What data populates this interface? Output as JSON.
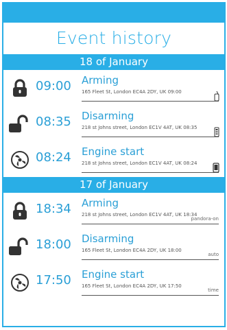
{
  "app": {
    "title": "Event history"
  },
  "groups": [
    {
      "date": "18 of January",
      "events": [
        {
          "icon": "lock-closed-icon",
          "time": "09:00",
          "event": "Arming",
          "address": "165 Fleet St, London EC4A 2DY, UK 09:00",
          "source": "",
          "device": "key-fob-icon"
        },
        {
          "icon": "lock-open-icon",
          "time": "08:35",
          "event": "Disarming",
          "address": "218 st Johns street, London EC1V 4AT, UK 08:35",
          "source": "",
          "device": "remote-icon"
        },
        {
          "icon": "engine-icon",
          "time": "08:24",
          "event": "Engine start",
          "address": "218 st Johns street, London EC1V 4AT, UK 08:24",
          "source": "",
          "device": "phone-icon"
        }
      ]
    },
    {
      "date": "17 of January",
      "events": [
        {
          "icon": "lock-closed-icon",
          "time": "18:34",
          "event": "Arming",
          "address": "218 st Johns street, London EC1V 4AT, UK 18:34",
          "source": "pandora-on",
          "device": ""
        },
        {
          "icon": "lock-open-icon",
          "time": "18:00",
          "event": "Disarming",
          "address": "165 Fleet St, London EC4A 2DY, UK 18:00",
          "source": "auto",
          "device": ""
        },
        {
          "icon": "engine-icon",
          "time": "17:50",
          "event": "Engine start",
          "address": "165 Fleet St, London EC4A 2DY, UK 17:50",
          "source": "time",
          "device": ""
        }
      ]
    }
  ],
  "colors": {
    "accent": "#29aee6",
    "text": "#2a9fd6"
  }
}
